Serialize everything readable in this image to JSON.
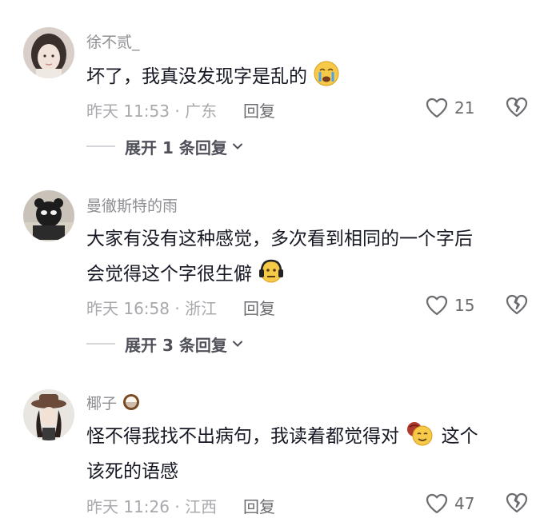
{
  "comments": [
    {
      "username": "徐不贰_",
      "content": "坏了，我真没发现字是乱的",
      "emoji": "crying-face-emoji",
      "time": "昨天 11:53",
      "location": "· 广东",
      "reply_label": "回复",
      "likes": "21",
      "expand_label": "展开 1 条回复"
    },
    {
      "username": "曼徹斯特的雨",
      "content_line1": "大家有没有这种感觉，多次看到相同的一个字后",
      "content_line2": "会觉得这个字很生僻",
      "emoji": "headphones-face-emoji",
      "time": "昨天 16:58",
      "location": "· 浙江",
      "reply_label": "回复",
      "likes": "15",
      "expand_label": "展开 3 条回复"
    },
    {
      "username": "椰子",
      "username_emoji": "coconut-emoji",
      "content_line1a": "怪不得我找不出病句，我读着都觉得对",
      "content_line1b": "这个",
      "content_line2": "该死的语感",
      "emoji": "smiling-face-emoji",
      "time": "昨天 11:26",
      "location": "· 江西",
      "reply_label": "回复",
      "likes": "47"
    }
  ],
  "colors": {
    "text_primary": "#161823",
    "text_secondary": "#8e8e93",
    "background": "#ffffff"
  }
}
